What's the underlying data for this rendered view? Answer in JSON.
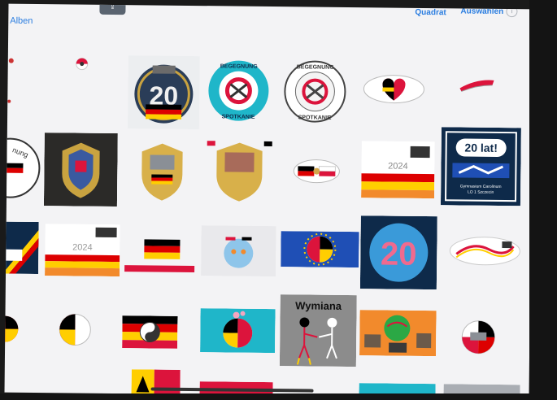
{
  "toolbar": {
    "albums_label": "Alben",
    "square_label": "Quadrat",
    "select_label": "Auswählen"
  },
  "tiles": {
    "count_badge": "20",
    "begegnung_text": "BEGEGNUNG",
    "spotkanie_text": "SPOTKANIE",
    "lat_title": "20 lat!",
    "school_name": "Gymnasium Carolinum",
    "school_sub": "LO 1 Szczecin",
    "year": "2024",
    "wymiana_title": "Wymiana",
    "partial_nung": "nung"
  },
  "colors": {
    "accent": "#2a7de0",
    "de_black": "#000000",
    "de_red": "#dd0000",
    "de_gold": "#ffce00",
    "pl_red": "#dc143c",
    "navy": "#0e2a4a",
    "eu_blue": "#1f4fb5",
    "teal_bg": "#1fb6c9"
  }
}
